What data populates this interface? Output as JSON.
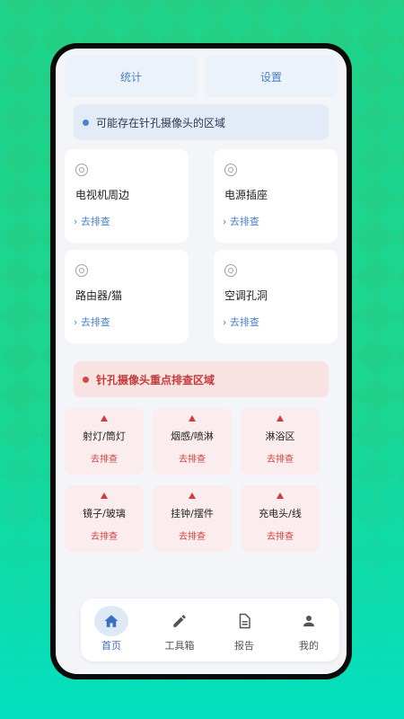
{
  "top_tabs": [
    "统计",
    "设置"
  ],
  "section_possible": {
    "title": "可能存在针孔摄像头的区域",
    "cards": [
      {
        "title": "电视机周边",
        "action": "› 去排查"
      },
      {
        "title": "电源插座",
        "action": "› 去排查"
      },
      {
        "title": "路由器/猫",
        "action": "› 去排查"
      },
      {
        "title": "空调孔洞",
        "action": "› 去排查"
      }
    ]
  },
  "section_focus": {
    "title": "针孔摄像头重点排查区域",
    "tiles": [
      {
        "name": "射灯/筒灯",
        "action": "去排查"
      },
      {
        "name": "烟感/喷淋",
        "action": "去排查"
      },
      {
        "name": "淋浴区",
        "action": "去排查"
      },
      {
        "name": "镜子/玻璃",
        "action": "去排查"
      },
      {
        "name": "挂钟/摆件",
        "action": "去排查"
      },
      {
        "name": "充电头/线",
        "action": "去排查"
      }
    ]
  },
  "bottom_nav": [
    {
      "label": "首页",
      "icon": "home-icon",
      "active": true
    },
    {
      "label": "工具箱",
      "icon": "pencil-icon",
      "active": false
    },
    {
      "label": "报告",
      "icon": "document-icon",
      "active": false
    },
    {
      "label": "我的",
      "icon": "person-icon",
      "active": false
    }
  ],
  "colors": {
    "accent_blue": "#4a82d6",
    "alert_red": "#d33a3a"
  }
}
